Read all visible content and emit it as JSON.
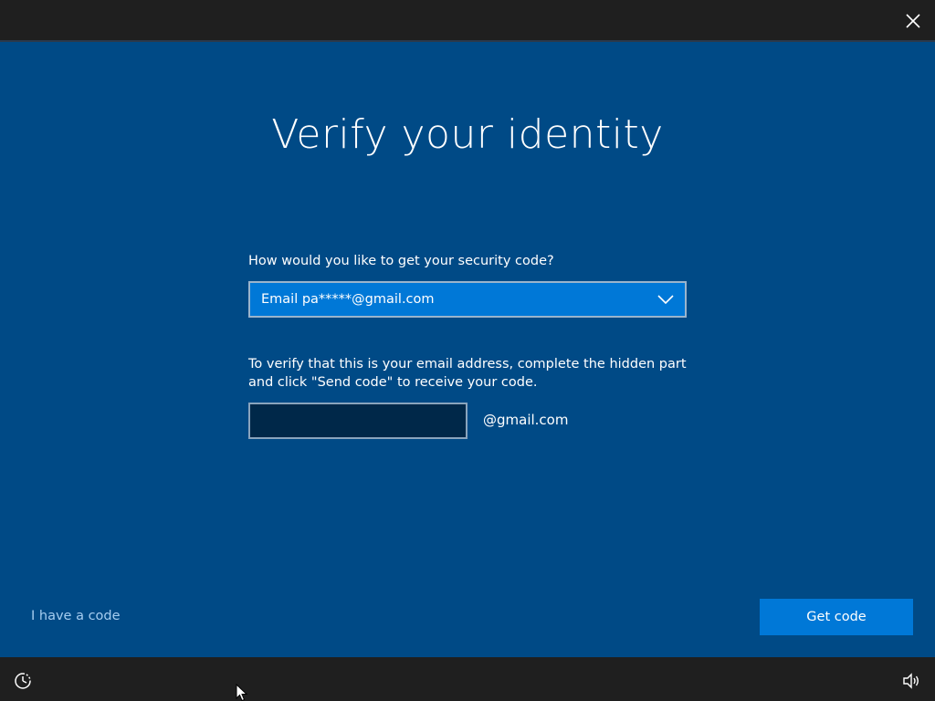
{
  "page": {
    "title": "Verify your identity",
    "question": "How would you like to get your security code?",
    "method_dropdown": {
      "selected": "Email pa*****@gmail.com"
    },
    "description": "To verify that this is your email address, complete the hidden part and click \"Send code\" to receive your code.",
    "email_input": {
      "value": "",
      "placeholder": ""
    },
    "email_domain": "@gmail.com",
    "have_code_link": "I have a code",
    "get_code_button": "Get code"
  },
  "icons": {
    "close": "close-icon",
    "chevron": "chevron-down-icon",
    "ease_of_access": "ease-of-access-icon",
    "volume": "volume-icon",
    "cursor": "mouse-cursor-icon"
  },
  "colors": {
    "background": "#004a86",
    "accent": "#0078d7",
    "bar": "#1f1f1f",
    "link": "#a6cdf0"
  }
}
